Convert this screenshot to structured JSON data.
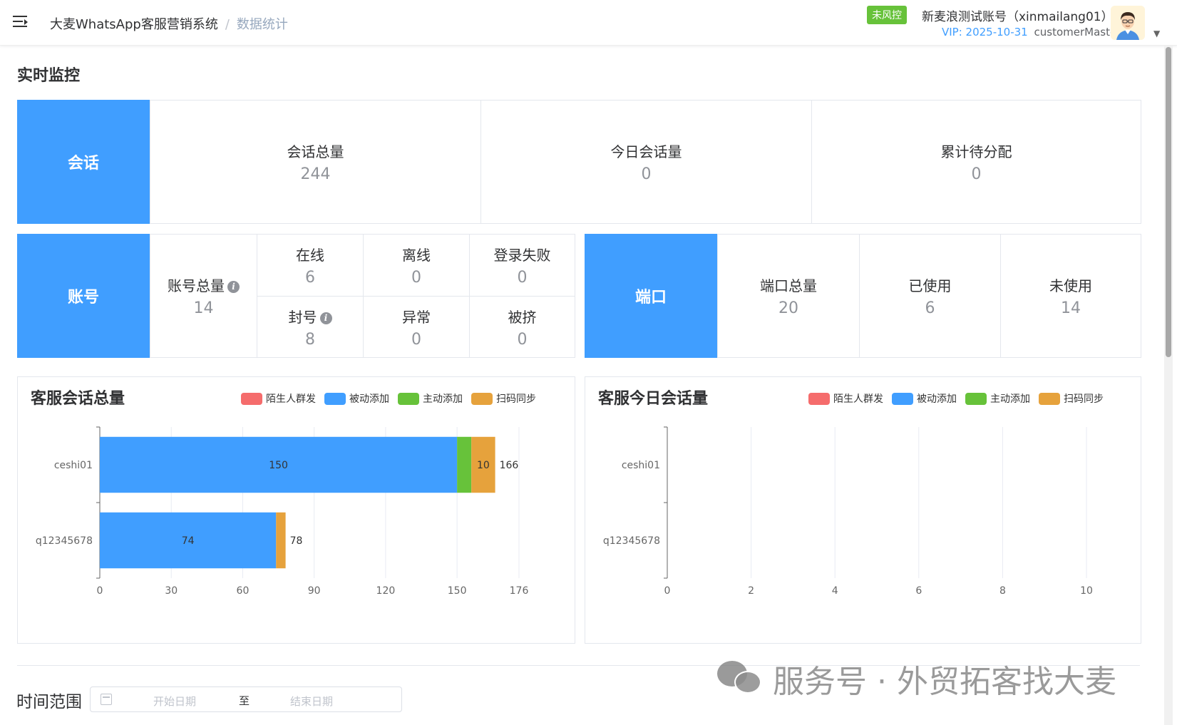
{
  "header": {
    "app_name": "大麦WhatsApp客服营销系统",
    "separator": "/",
    "current_page": "数据统计",
    "risk_badge": "未风控",
    "account_name": "新麦浪测试账号（xinmailang01）",
    "vip": "VIP: 2025-10-31",
    "role": "customerMaster"
  },
  "realtime": {
    "title": "实时监控",
    "session": {
      "label": "会话",
      "total_label": "会话总量",
      "total_value": "244",
      "today_label": "今日会话量",
      "today_value": "0",
      "pending_label": "累计待分配",
      "pending_value": "0"
    },
    "account": {
      "label": "账号",
      "total_label": "账号总量",
      "total_value": "14",
      "online_label": "在线",
      "online_value": "6",
      "offline_label": "离线",
      "offline_value": "0",
      "login_fail_label": "登录失败",
      "login_fail_value": "0",
      "banned_label": "封号",
      "banned_value": "8",
      "abnormal_label": "异常",
      "abnormal_value": "0",
      "kicked_label": "被挤",
      "kicked_value": "0"
    },
    "port": {
      "label": "端口",
      "total_label": "端口总量",
      "total_value": "20",
      "used_label": "已使用",
      "used_value": "6",
      "unused_label": "未使用",
      "unused_value": "14"
    }
  },
  "legend": [
    {
      "name": "陌生人群发",
      "color": "#f56c6c"
    },
    {
      "name": "被动添加",
      "color": "#409eff"
    },
    {
      "name": "主动添加",
      "color": "#67c23a"
    },
    {
      "name": "扫码同步",
      "color": "#e6a23c"
    }
  ],
  "chart_data": [
    {
      "type": "bar",
      "orientation": "horizontal",
      "stacked": true,
      "title": "客服会话总量",
      "categories": [
        "ceshi01",
        "q12345678"
      ],
      "series": [
        {
          "name": "陌生人群发",
          "values": [
            0,
            0
          ]
        },
        {
          "name": "被动添加",
          "values": [
            150,
            74
          ]
        },
        {
          "name": "主动添加",
          "values": [
            6,
            0
          ]
        },
        {
          "name": "扫码同步",
          "values": [
            10,
            4
          ]
        }
      ],
      "data_labels": [
        [
          "150",
          "",
          "10"
        ],
        [
          "74",
          "",
          ""
        ]
      ],
      "totals": [
        166,
        78
      ],
      "xlim": [
        0,
        176
      ],
      "xticks": [
        "0",
        "30",
        "60",
        "90",
        "120",
        "150",
        "176"
      ],
      "grid": true,
      "legend": "top-right"
    },
    {
      "type": "bar",
      "orientation": "horizontal",
      "stacked": true,
      "title": "客服今日会话量",
      "categories": [
        "ceshi01",
        "q12345678"
      ],
      "series": [
        {
          "name": "陌生人群发",
          "values": [
            0,
            0
          ]
        },
        {
          "name": "被动添加",
          "values": [
            0,
            0
          ]
        },
        {
          "name": "主动添加",
          "values": [
            0,
            0
          ]
        },
        {
          "name": "扫码同步",
          "values": [
            0,
            0
          ]
        }
      ],
      "xlim": [
        0,
        10
      ],
      "xticks": [
        "0",
        "2",
        "4",
        "6",
        "8",
        "10"
      ],
      "grid": true,
      "legend": "top-right"
    }
  ],
  "filter": {
    "time_label": "时间范围",
    "start_placeholder": "开始日期",
    "to": "至",
    "end_placeholder": "结束日期"
  },
  "watermark": "服务号 · 外贸拓客找大麦"
}
